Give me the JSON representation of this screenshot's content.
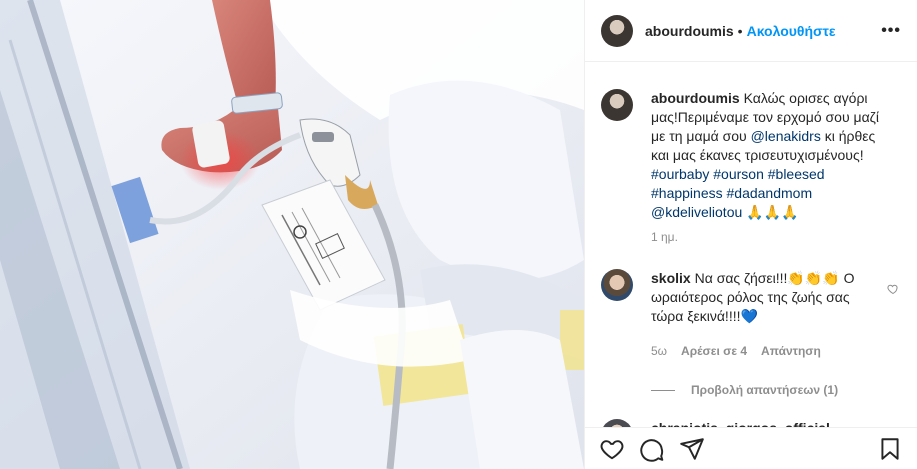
{
  "header": {
    "username": "abourdoumis",
    "separator": "•",
    "follow_label": "Ακολουθήστε",
    "more_label": "•••"
  },
  "caption": {
    "username": "abourdoumis",
    "text_before_mention": "Καλώς ορισες αγόρι μας!Περιμέναμε τον ερχομό σου μαζί με τη μαμά σου ",
    "mention": "@lenakidrs",
    "text_after_mention": " κι ήρθες και μας έκανες τρισευτυχισμένους! ",
    "hashtags": "#ourbaby #ourson #bleesed #happiness #dadandmom",
    "mention2": "@kdeliveliotou",
    "emoji": " 🙏🙏🙏",
    "time": "1 ημ."
  },
  "comments": [
    {
      "username": "skolix",
      "text": "Να σας ζήσει!!!👏👏👏 Ο ωραιότερος ρόλος της ζωής σας τώρα ξεκινά!!!!💙",
      "time": "5ω",
      "likes": "Αρέσει σε 4",
      "reply": "Απάντηση"
    },
    {
      "username": "chraniotis_giorgos_official"
    }
  ],
  "view_replies": "Προβολή απαντήσεων (1)",
  "icons": {
    "like": "heart-icon",
    "comment": "comment-icon",
    "share": "send-icon",
    "save": "bookmark-icon"
  },
  "colors": {
    "accent": "#0095f6",
    "mention": "#00376b",
    "muted": "#8e8e8e"
  }
}
